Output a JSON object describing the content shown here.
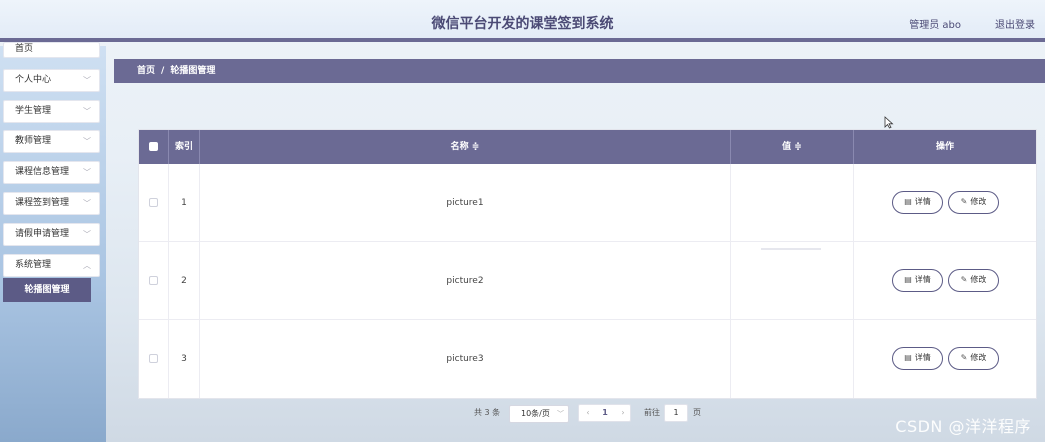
{
  "header": {
    "title": "微信平台开发的课堂签到系统",
    "admin": "管理员 abo",
    "logout": "退出登录"
  },
  "sidebar": {
    "items": [
      {
        "label": "首页"
      },
      {
        "label": "个人中心"
      },
      {
        "label": "学生管理"
      },
      {
        "label": "教师管理"
      },
      {
        "label": "课程信息管理"
      },
      {
        "label": "课程签到管理"
      },
      {
        "label": "请假申请管理"
      },
      {
        "label": "系统管理"
      }
    ],
    "submenu": {
      "label": "轮播图管理"
    }
  },
  "breadcrumb": {
    "home": "首页",
    "sep": "/",
    "current": "轮播图管理"
  },
  "table": {
    "columns": {
      "index": "索引",
      "name": "名称 ≑",
      "value": "值 ≑",
      "action": "操作"
    },
    "rows": [
      {
        "index": "1",
        "name": "picture1"
      },
      {
        "index": "2",
        "name": "picture2"
      },
      {
        "index": "3",
        "name": "picture3"
      }
    ],
    "detail_label": "详情",
    "edit_label": "修改"
  },
  "pagination": {
    "total": "共 3 条",
    "page_size": "10条/页",
    "current_page": "1",
    "goto_label": "前往",
    "goto_value": "1",
    "page_unit": "页"
  },
  "watermark": "CSDN @洋洋程序",
  "colors": {
    "accent": "#6b6a94",
    "accent_dark": "#5c5b86"
  }
}
